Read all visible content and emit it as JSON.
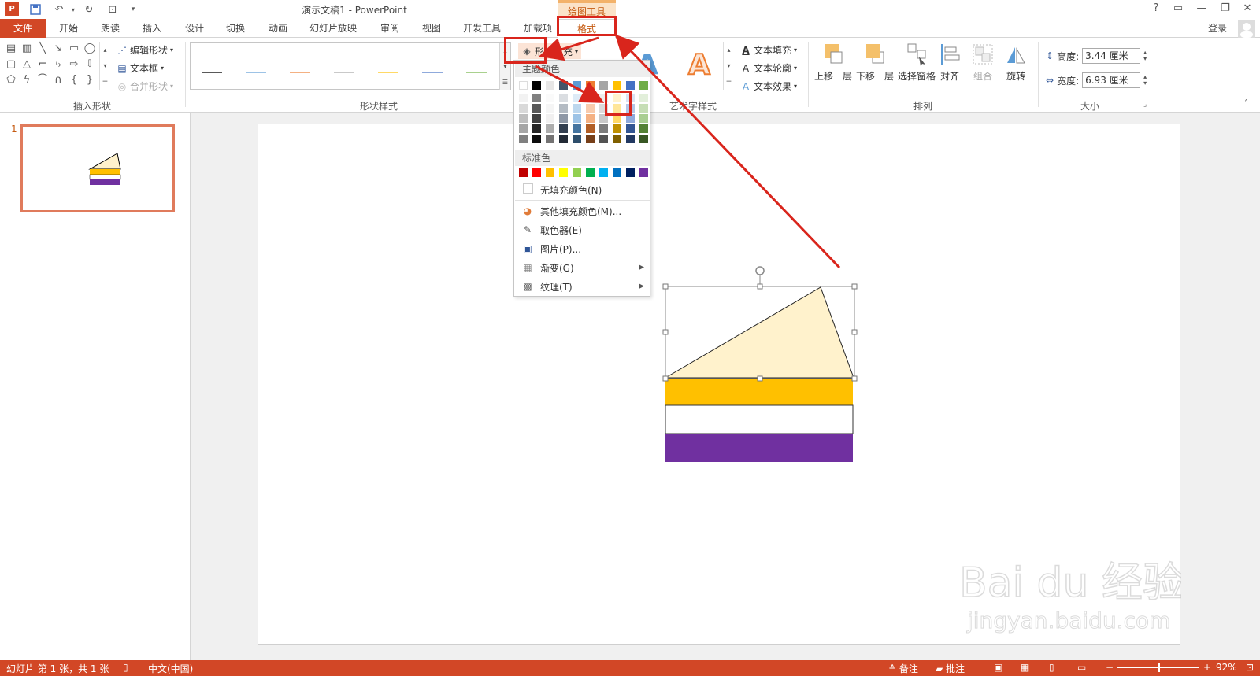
{
  "titlebar": {
    "app_icon": "P",
    "title": "演示文稿1 - PowerPoint",
    "context_tab_group": "绘图工具",
    "icons": [
      "save-icon",
      "undo-icon",
      "redo-icon",
      "start-presentation-icon",
      "customize-icon"
    ],
    "controls": [
      "?",
      "▭",
      "—",
      "❐",
      "✕"
    ]
  },
  "tabs": {
    "file": "文件",
    "items": [
      "开始",
      "朗读",
      "插入",
      "设计",
      "切换",
      "动画",
      "幻灯片放映",
      "审阅",
      "视图",
      "开发工具",
      "加载项"
    ],
    "format": "格式",
    "login": "登录"
  },
  "ribbon": {
    "insert_shapes": {
      "label": "插入形状",
      "edit_shape": "编辑形状",
      "text_box": "文本框",
      "merge_shapes": "合并形状"
    },
    "shape_styles": {
      "label": "形状样式",
      "shape_fill": "形状填充",
      "line_colors": [
        "#595959",
        "#9dc3e6",
        "#f4b183",
        "#c9c9c9",
        "#ffd966",
        "#8faadc",
        "#a9d18e"
      ]
    },
    "wordart": {
      "label": "艺术字样式",
      "text_fill": "文本填充",
      "text_outline": "文本轮廓",
      "text_effects": "文本效果",
      "sample_letter": "A"
    },
    "arrange": {
      "label": "排列",
      "bring_forward": "上移一层",
      "send_backward": "下移一层",
      "selection_pane": "选择窗格",
      "align": "对齐",
      "group": "组合",
      "rotate": "旋转"
    },
    "size": {
      "label": "大小",
      "height_label": "高度:",
      "height_value": "3.44 厘米",
      "width_label": "宽度:",
      "width_value": "6.93 厘米"
    }
  },
  "fill_menu": {
    "theme_colors_header": "主题颜色",
    "theme_colors_top": [
      "#ffffff",
      "#000000",
      "#e7e6e6",
      "#44546a",
      "#5b9bd5",
      "#ed7d31",
      "#a5a5a5",
      "#ffc000",
      "#4472c4",
      "#70ad47"
    ],
    "standard_colors_header": "标准色",
    "standard_colors": [
      "#c00000",
      "#ff0000",
      "#ffc000",
      "#ffff00",
      "#92d050",
      "#00b050",
      "#00b0f0",
      "#0070c0",
      "#002060",
      "#7030a0"
    ],
    "no_fill": "无填充颜色(N)",
    "more_colors": "其他填充颜色(M)...",
    "eyedropper": "取色器(E)",
    "picture": "图片(P)...",
    "gradient": "渐变(G)",
    "texture": "纹理(T)"
  },
  "slide": {
    "thumbnail_number": "1",
    "triangle_fill": "#fff2cc",
    "band_colors": [
      "#ffc000",
      "#ffffff",
      "#7030a0"
    ]
  },
  "statusbar": {
    "slide_info": "幻灯片 第 1 张，共 1 张",
    "language": "中文(中国)",
    "notes": "备注",
    "comments": "批注",
    "zoom": "92%"
  },
  "watermark": {
    "brand": "Bai du 经验",
    "url": "jingyan.baidu.com"
  }
}
